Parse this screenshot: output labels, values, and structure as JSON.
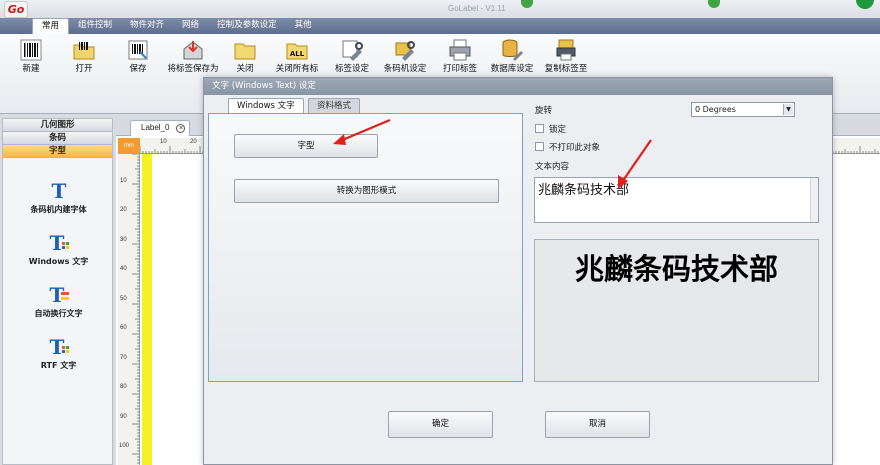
{
  "app": {
    "logo": "Go",
    "title": "GoLabel - V1.11"
  },
  "ribbon_tabs": [
    "常用",
    "组件控制",
    "物件对齐",
    "网络",
    "控制及参数设定",
    "其他"
  ],
  "toolbar": [
    {
      "label": "新建",
      "icon": "new-barcode-icon"
    },
    {
      "label": "打开",
      "icon": "open-folder-icon"
    },
    {
      "label": "保存",
      "icon": "save-icon"
    },
    {
      "label": "将标签保存为",
      "icon": "save-as-icon"
    },
    {
      "label": "关闭",
      "icon": "close-folder-icon"
    },
    {
      "label": "关闭所有标",
      "icon": "close-all-icon",
      "badge": "ALL"
    },
    {
      "label": "标签设定",
      "icon": "label-settings-icon"
    },
    {
      "label": "条码机设定",
      "icon": "printer-settings-icon"
    },
    {
      "label": "打印标签",
      "icon": "print-icon"
    },
    {
      "label": "数据库设定",
      "icon": "database-icon"
    },
    {
      "label": "复制标签至",
      "icon": "copy-label-icon"
    }
  ],
  "left_panel": {
    "categories": [
      "几何图形",
      "条码",
      "字型"
    ],
    "active_category": "字型",
    "items": [
      {
        "label": "条码机内建字体",
        "icon": "builtin-font-icon"
      },
      {
        "label": "Windows 文字",
        "icon": "windows-text-icon"
      },
      {
        "label": "自动换行文字",
        "icon": "wrap-text-icon"
      },
      {
        "label": "RTF 文字",
        "icon": "rtf-text-icon"
      }
    ]
  },
  "canvas": {
    "tab_label": "Label_0",
    "ruler_unit": "mm",
    "h_ticks": [
      "10",
      "20"
    ],
    "v_ticks": [
      "10",
      "20",
      "30",
      "40",
      "50",
      "60",
      "70",
      "80",
      "90",
      "100"
    ]
  },
  "dialog": {
    "title": "文字 (Windows Text) 设定",
    "tabs": [
      "Windows 文字",
      "资料格式"
    ],
    "font_button": "字型",
    "convert_button": "转换为图形模式",
    "rotation_label": "旋转",
    "rotation_value": "0 Degrees",
    "lock_label": "锁定",
    "lock_checked": false,
    "no_print_label": "不打印此对象",
    "no_print_checked": false,
    "content_label": "文本内容",
    "content_value": "兆麟条码技术部",
    "preview_text": "兆麟条码技术部",
    "ok_button": "确定",
    "cancel_button": "取消"
  },
  "colors": {
    "annotation_arrow": "#e0201b",
    "ruler_corner": "#f39a31",
    "active_category": "#f6b94a",
    "guide_strip": "#f3f227"
  }
}
